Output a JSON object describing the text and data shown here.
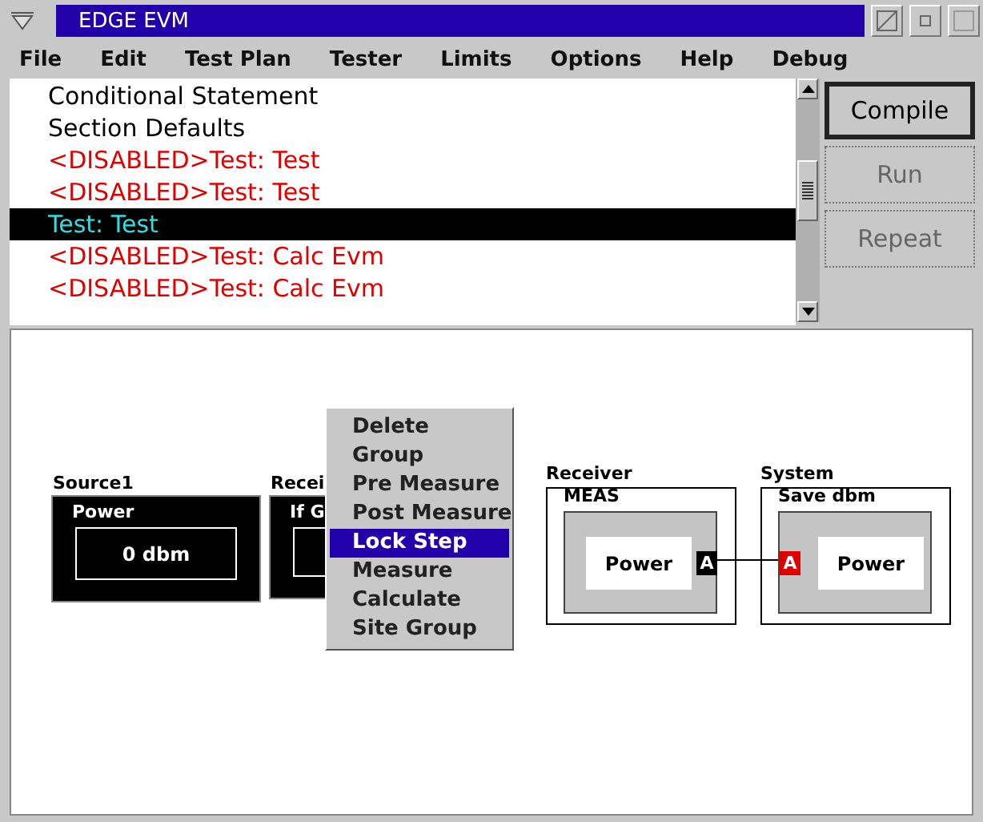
{
  "window": {
    "title": "EDGE EVM"
  },
  "menu_bar": [
    {
      "label": "File"
    },
    {
      "label": "Edit"
    },
    {
      "label": "Test Plan"
    },
    {
      "label": "Tester"
    },
    {
      "label": "Limits"
    },
    {
      "label": "Options"
    },
    {
      "label": "Help"
    },
    {
      "label": "Debug"
    }
  ],
  "test_list": [
    {
      "label": "Conditional Statement",
      "disabled": false,
      "selected": false
    },
    {
      "label": "Section Defaults",
      "disabled": false,
      "selected": false
    },
    {
      "label": "<DISABLED>Test: Test",
      "disabled": true,
      "selected": false
    },
    {
      "label": "<DISABLED>Test: Test",
      "disabled": true,
      "selected": false
    },
    {
      "label": "Test: Test",
      "disabled": false,
      "selected": true
    },
    {
      "label": "<DISABLED>Test: Calc Evm",
      "disabled": true,
      "selected": false
    },
    {
      "label": "<DISABLED>Test: Calc Evm",
      "disabled": true,
      "selected": false
    }
  ],
  "buttons": [
    {
      "label": "Compile",
      "default": true,
      "disabled": false
    },
    {
      "label": "Run",
      "default": false,
      "disabled": true
    },
    {
      "label": "Repeat",
      "default": false,
      "disabled": true
    }
  ],
  "nodes": [
    {
      "kind": "dark",
      "label": "Source1",
      "title": "Power",
      "value": "0 dbm"
    },
    {
      "kind": "dark",
      "label": "Recei",
      "title": "If G"
    },
    {
      "kind": "light",
      "label": "Receiver",
      "title": "MEAS",
      "value": "Power",
      "port": "A",
      "color": "#000000"
    },
    {
      "kind": "light",
      "label": "System",
      "title": "Save dbm",
      "value": "Power",
      "port": "A",
      "color": "#e00000"
    }
  ],
  "context_menu": [
    {
      "label": "Delete",
      "selected": false
    },
    {
      "label": "Group",
      "selected": false
    },
    {
      "label": "Pre Measure",
      "selected": false
    },
    {
      "label": "Post Measure",
      "selected": false
    },
    {
      "label": "Lock Step",
      "selected": true
    },
    {
      "label": "Measure",
      "selected": false
    },
    {
      "label": "Calculate",
      "selected": false
    },
    {
      "label": "Site Group",
      "selected": false
    }
  ]
}
